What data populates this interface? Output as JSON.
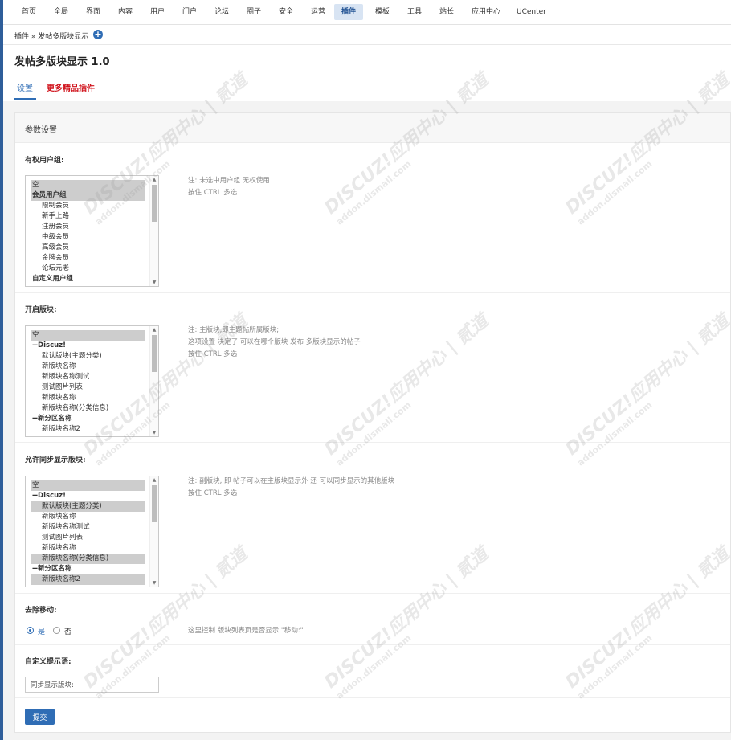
{
  "nav": {
    "items": [
      "首页",
      "全局",
      "界面",
      "内容",
      "用户",
      "门户",
      "论坛",
      "圈子",
      "安全",
      "运营",
      "插件",
      "模板",
      "工具",
      "站长",
      "应用中心",
      "UCenter"
    ],
    "active_index": 10
  },
  "breadcrumb": "插件 » 发帖多版块显示",
  "plugin_title": "发帖多版块显示 1.0",
  "tabs": {
    "settings": "设置",
    "more": "更多精品插件"
  },
  "panel_title": "参数设置",
  "field1": {
    "label": "有权用户组:",
    "options": [
      {
        "text": "空",
        "style": "sel"
      },
      {
        "text": "会员用户组",
        "style": "grp sel"
      },
      {
        "text": "限制会员",
        "style": "sub"
      },
      {
        "text": "新手上路",
        "style": "sub"
      },
      {
        "text": "注册会员",
        "style": "sub"
      },
      {
        "text": "中级会员",
        "style": "sub"
      },
      {
        "text": "高级会员",
        "style": "sub"
      },
      {
        "text": "金牌会员",
        "style": "sub"
      },
      {
        "text": "论坛元老",
        "style": "sub"
      },
      {
        "text": "自定义用户组",
        "style": "grp"
      }
    ],
    "notes": [
      "注: 未选中用户组 无权使用",
      "按住 CTRL 多选"
    ]
  },
  "field2": {
    "label": "开启版块:",
    "options": [
      {
        "text": "空",
        "style": "sel"
      },
      {
        "text": "--Discuz!",
        "style": "grp"
      },
      {
        "text": "默认版块(主题分类)",
        "style": "sub"
      },
      {
        "text": "新版块名称",
        "style": "sub"
      },
      {
        "text": "新版块名称测试",
        "style": "sub"
      },
      {
        "text": "测试图片列表",
        "style": "sub"
      },
      {
        "text": "新版块名称",
        "style": "sub"
      },
      {
        "text": "新版块名称(分类信息)",
        "style": "sub"
      },
      {
        "text": "--新分区名称",
        "style": "grp"
      },
      {
        "text": "新版块名称2",
        "style": "sub"
      }
    ],
    "notes": [
      "注: 主版块,即主题帖所属版块;",
      "这项设置 决定了 可以在哪个版块 发布 多版块显示的帖子",
      "按住 CTRL 多选"
    ]
  },
  "field3": {
    "label": "允许同步显示版块:",
    "options": [
      {
        "text": "空",
        "style": "sel"
      },
      {
        "text": "--Discuz!",
        "style": "grp"
      },
      {
        "text": "默认版块(主题分类)",
        "style": "sub sel"
      },
      {
        "text": "新版块名称",
        "style": "sub"
      },
      {
        "text": "新版块名称测试",
        "style": "sub"
      },
      {
        "text": "测试图片列表",
        "style": "sub"
      },
      {
        "text": "新版块名称",
        "style": "sub"
      },
      {
        "text": "新版块名称(分类信息)",
        "style": "sub sel"
      },
      {
        "text": "--新分区名称",
        "style": "grp"
      },
      {
        "text": "新版块名称2",
        "style": "sub sel"
      }
    ],
    "notes": [
      "注: 副版块, 即 帖子可以在主版块显示外 还 可以同步显示的其他版块",
      "按住 CTRL 多选"
    ]
  },
  "field4": {
    "label": "去除移动:",
    "yes": "是",
    "no": "否",
    "selected": "是",
    "note": "这里控制 版块列表页是否显示 \"移动:\""
  },
  "field5": {
    "label": "自定义提示语:",
    "value": "同步显示版块:"
  },
  "submit_label": "提交",
  "watermark": {
    "line1": "DISCUZ!应用中心 | 贰道",
    "line2": "addon.dismall.com"
  },
  "colors": {
    "accent": "#2f6db5",
    "more_link": "#d0121b",
    "selected_option": "#cdcdcd",
    "sidebar": "#2f5e9a"
  }
}
